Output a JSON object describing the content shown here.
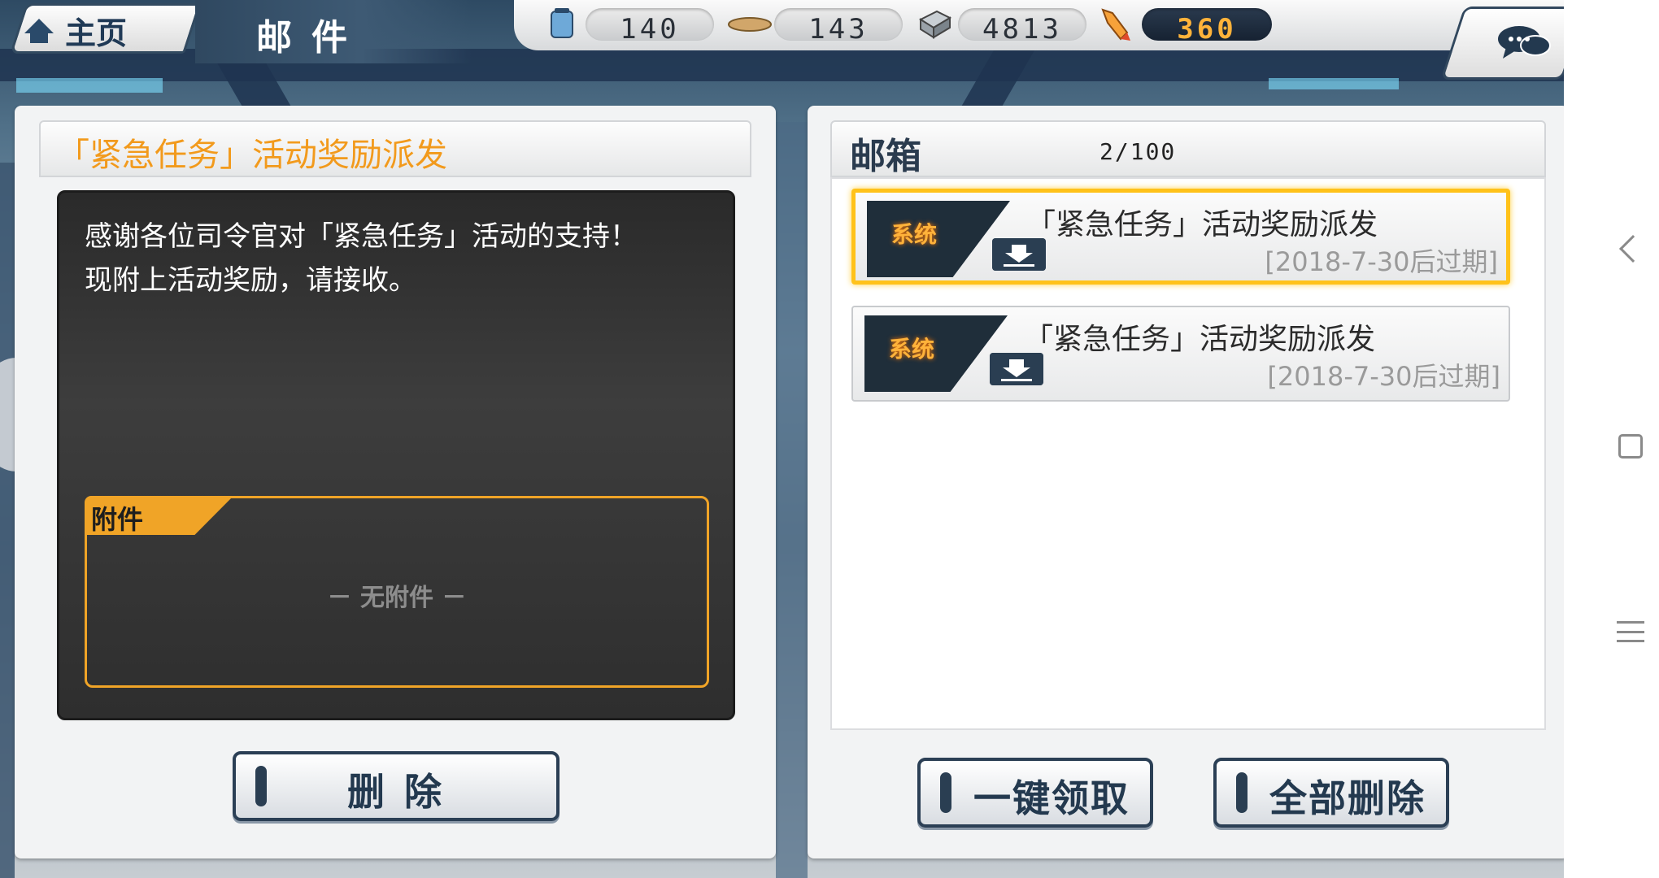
{
  "topbar": {
    "home_label": "主页",
    "page_title": "邮件",
    "resources": {
      "fuel": "140",
      "ammo": "143",
      "steel": "4813",
      "premium": "360"
    }
  },
  "message": {
    "title": "「紧急任务」活动奖励派发",
    "body_line1": "感谢各位司令官对「紧急任务」活动的支持！",
    "body_line2": "现附上活动奖励，请接收。",
    "attachment_label": "附件",
    "no_attachment_text": "－ 无附件 －",
    "delete_label": "删 除"
  },
  "mailbox": {
    "title": "邮箱",
    "count": "2/100",
    "items": [
      {
        "tag": "系统",
        "subject": "「紧急任务」活动奖励派发",
        "expire": "[2018-7-30后过期]",
        "selected": true
      },
      {
        "tag": "系统",
        "subject": "「紧急任务」活动奖励派发",
        "expire": "[2018-7-30后过期]",
        "selected": false
      }
    ],
    "claim_all_label": "一键领取",
    "delete_all_label": "全部删除"
  },
  "colors": {
    "accent_orange": "#f29a1c",
    "selected_border": "#ffc21a",
    "dark_navy": "#2b3f55"
  },
  "icons": [
    "home-icon",
    "fuel-icon",
    "ammo-icon",
    "steel-icon",
    "premium-icon",
    "chat-icon",
    "download-icon",
    "nav-back-icon",
    "nav-home-icon",
    "nav-menu-icon"
  ]
}
